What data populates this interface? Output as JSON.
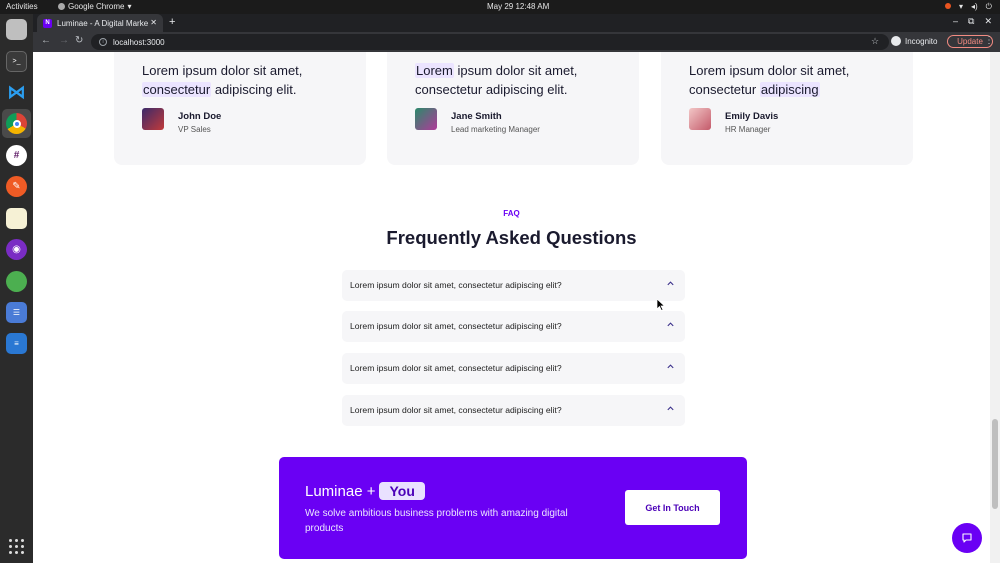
{
  "system": {
    "activities": "Activities",
    "app_name": "Google Chrome",
    "clock": "May 29  12:48 AM"
  },
  "browser": {
    "tab_title": "Luminae - A Digital Marke",
    "favicon_letter": "N",
    "url": "localhost:3000",
    "incognito_label": "Incognito",
    "update_label": "Update"
  },
  "testimonials": [
    {
      "quote_prefix": "Lorem ipsum dolor sit amet,",
      "quote_highlight": "consectetur",
      "quote_suffix": "adipiscing elit.",
      "name": "John Doe",
      "role": "VP Sales",
      "avatar_color": "#c23a3a"
    },
    {
      "quote_highlight": "Lorem",
      "quote_suffix": "ipsum dolor sit amet, consectetur adipiscing elit.",
      "name": "Jane Smith",
      "role": "Lead marketing Manager",
      "avatar_color": "#b03a9a"
    },
    {
      "quote_prefix": "Lorem ipsum dolor sit amet, consectetur",
      "quote_highlight": "adipiscing",
      "name": "Emily Davis",
      "role": "HR Manager",
      "avatar_color": "#d9868a"
    }
  ],
  "faq": {
    "label": "FAQ",
    "title": "Frequently Asked Questions",
    "items": [
      {
        "question": "Lorem ipsum dolor sit amet, consectetur adipiscing elit?"
      },
      {
        "question": "Lorem ipsum dolor sit amet, consectetur adipiscing elit?"
      },
      {
        "question": "Lorem ipsum dolor sit amet, consectetur adipiscing elit?"
      },
      {
        "question": "Lorem ipsum dolor sit amet, consectetur adipiscing elit?"
      }
    ]
  },
  "cta": {
    "brand": "Luminae +",
    "brand_badge": "You",
    "subtitle": "We solve ambitious business problems with amazing digital products",
    "button": "Get In Touch"
  },
  "colors": {
    "accent": "#6a00f4",
    "card_bg": "#f6f6f8",
    "highlight_bg": "#ebe4ff"
  },
  "icons": {
    "faq_chevron": "chevron-up-icon",
    "chat": "chat-bubble-icon"
  }
}
